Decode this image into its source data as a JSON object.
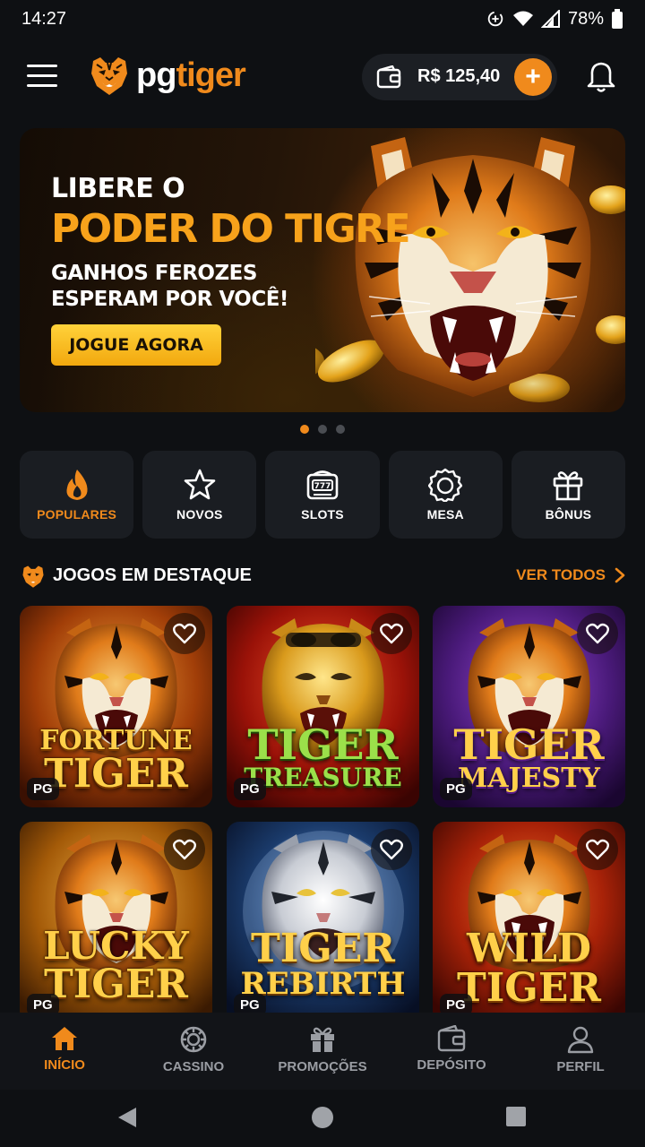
{
  "status_bar": {
    "time": "14:27",
    "battery": "78%"
  },
  "header": {
    "logo_pg": "pg",
    "logo_tiger": "tiger",
    "balance": "R$ 125,40",
    "add_label": "+"
  },
  "banner": {
    "line1": "LIBERE O",
    "line2": "PODER DO TIGRE",
    "line3a": "GANHOS FEROZES",
    "line3b": "ESPERAM POR VOCÊ!",
    "cta": "JOGUE AGORA",
    "slides": 3,
    "active_slide": 1
  },
  "categories": [
    {
      "label": "POPULARES",
      "icon": "fire-icon",
      "active": true
    },
    {
      "label": "NOVOS",
      "icon": "star-icon",
      "active": false
    },
    {
      "label": "SLOTS",
      "icon": "slot-machine-icon",
      "active": false
    },
    {
      "label": "MESA",
      "icon": "poker-chip-icon",
      "active": false
    },
    {
      "label": "BÔNUS",
      "icon": "gift-icon",
      "active": false
    }
  ],
  "featured": {
    "title": "JOGOS EM DESTAQUE",
    "see_all": "VER TODOS",
    "games": [
      {
        "t1": "FORTUNE",
        "t2": "TIGER",
        "provider": "PG",
        "theme": "orange"
      },
      {
        "t1": "TIGER",
        "t2": "TREASURE",
        "provider": "PG",
        "theme": "red"
      },
      {
        "t1": "TIGER",
        "t2": "MAJESTY",
        "provider": "PG",
        "theme": "purple"
      },
      {
        "t1": "LUCKY",
        "t2": "TIGER",
        "provider": "PG",
        "theme": "gold"
      },
      {
        "t1": "TIGER",
        "t2": "REBIRTH",
        "provider": "PG",
        "theme": "blue"
      },
      {
        "t1": "WILD",
        "t2": "TIGER",
        "provider": "PG",
        "theme": "fire"
      }
    ]
  },
  "bottom_nav": [
    {
      "label": "INÍCIO",
      "icon": "home-icon",
      "active": true
    },
    {
      "label": "CASSINO",
      "icon": "casino-chip-icon",
      "active": false
    },
    {
      "label": "PROMOÇÕES",
      "icon": "gift-icon",
      "active": false
    },
    {
      "label": "DEPÓSITO",
      "icon": "wallet-icon",
      "active": false
    },
    {
      "label": "PERFIL",
      "icon": "user-icon",
      "active": false
    }
  ],
  "colors": {
    "accent": "#f08a1c",
    "background": "#0e1013",
    "card": "#1a1d22"
  }
}
